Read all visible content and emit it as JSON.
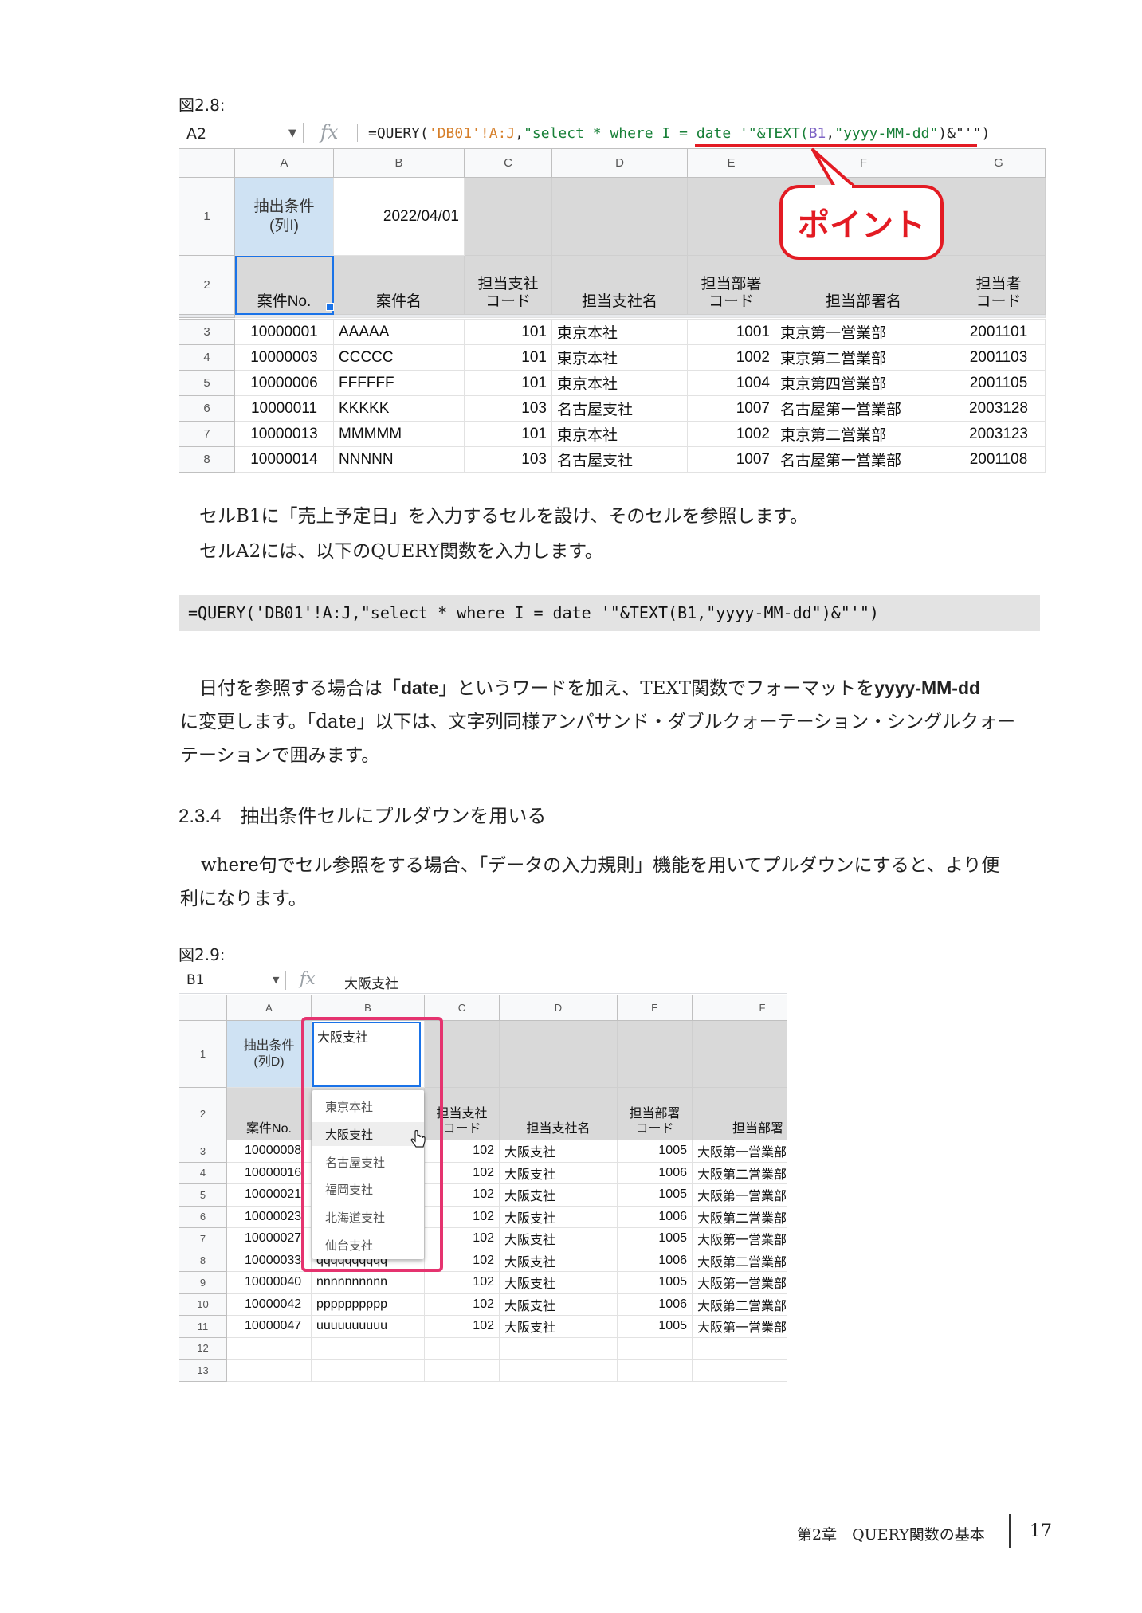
{
  "fig1": {
    "label": "図2.8:",
    "namebox": "A2",
    "fx": "fx",
    "formula": {
      "p1": "=QUERY(",
      "p2": "'DB01'!A:J",
      "p3": ",",
      "p4": "\"select * where I = ",
      "p5": "date '\"&TEXT(",
      "p6": "B1",
      "p7": ",",
      "p8": "\"yyyy-MM-dd\"",
      "p9": ")&\"'\")"
    },
    "callout": "ポイント",
    "col_headers": [
      "A",
      "B",
      "C",
      "D",
      "E",
      "F",
      "G"
    ],
    "row1": {
      "num": "1",
      "a_line1": "抽出条件",
      "a_line2": "(列I)",
      "b": "2022/04/01"
    },
    "row2": {
      "num": "2",
      "a": "案件No.",
      "b": "案件名",
      "c1": "担当支社",
      "c2": "コード",
      "d": "担当支社名",
      "e1": "担当部署",
      "e2": "コード",
      "f": "担当部署名",
      "g1": "担当者",
      "g2": "コード"
    },
    "rows": [
      [
        "3",
        "10000001",
        "AAAAA",
        "101",
        "東京本社",
        "1001",
        "東京第一営業部",
        "2001101"
      ],
      [
        "4",
        "10000003",
        "CCCCC",
        "101",
        "東京本社",
        "1002",
        "東京第二営業部",
        "2001103"
      ],
      [
        "5",
        "10000006",
        "FFFFFF",
        "101",
        "東京本社",
        "1004",
        "東京第四営業部",
        "2001105"
      ],
      [
        "6",
        "10000011",
        "KKKKK",
        "103",
        "名古屋支社",
        "1007",
        "名古屋第一営業部",
        "2003128"
      ],
      [
        "7",
        "10000013",
        "MMMMM",
        "101",
        "東京本社",
        "1002",
        "東京第二営業部",
        "2003123"
      ],
      [
        "8",
        "10000014",
        "NNNNN",
        "103",
        "名古屋支社",
        "1007",
        "名古屋第一営業部",
        "2001108"
      ]
    ]
  },
  "text1": {
    "line1": "セルB1に「売上予定日」を入力するセルを設け、そのセルを参照します。",
    "line2": "セルA2には、以下のQUERY関数を入力します。"
  },
  "code": "=QUERY('DB01'!A:J,\"select * where I = date '\"&TEXT(B1,\"yyyy-MM-dd\")&\"'\")",
  "text2": {
    "l1a": "日付を参照する場合は「",
    "l1b": "date",
    "l1c": "」というワードを加え、TEXT関数でフォーマットを",
    "l1d": "yyyy-MM-dd",
    "line2": "に変更します。「date」以下は、文字列同様アンパサンド・ダブルクォーテーション・シングルクォー",
    "line3": "テーションで囲みます。"
  },
  "heading": "2.3.4　抽出条件セルにプルダウンを用いる",
  "text3": {
    "line1": "where句でセル参照をする場合、「データの入力規則」機能を用いてプルダウンにすると、より便",
    "line2": "利になります。"
  },
  "fig2": {
    "label": "図2.9:",
    "namebox": "B1",
    "fx": "fx",
    "formula": "大阪支社",
    "col_headers": [
      "A",
      "B",
      "C",
      "D",
      "E",
      "F"
    ],
    "row1": {
      "num": "1",
      "a_line1": "抽出条件",
      "a_line2": "(列D)",
      "b": "大阪支社"
    },
    "row2": {
      "num": "2",
      "a": "案件No.",
      "c1": "担当支社",
      "c2": "コード",
      "d": "担当支社名",
      "e1": "担当部署",
      "e2": "コード",
      "f": "担当部署"
    },
    "rows": [
      [
        "3",
        "10000008",
        "",
        "102",
        "大阪支社",
        "1005",
        "大阪第一営業部"
      ],
      [
        "4",
        "10000016",
        "",
        "102",
        "大阪支社",
        "1006",
        "大阪第二営業部"
      ],
      [
        "5",
        "10000021",
        "",
        "102",
        "大阪支社",
        "1005",
        "大阪第一営業部"
      ],
      [
        "6",
        "10000023",
        "",
        "102",
        "大阪支社",
        "1006",
        "大阪第二営業部"
      ],
      [
        "7",
        "10000027",
        "",
        "102",
        "大阪支社",
        "1005",
        "大阪第一営業部"
      ],
      [
        "8",
        "10000033",
        "qqqqqqqqqq",
        "102",
        "大阪支社",
        "1006",
        "大阪第二営業部"
      ],
      [
        "9",
        "10000040",
        "nnnnnnnnnn",
        "102",
        "大阪支社",
        "1005",
        "大阪第一営業部"
      ],
      [
        "10",
        "10000042",
        "pppppppppp",
        "102",
        "大阪支社",
        "1006",
        "大阪第二営業部"
      ],
      [
        "11",
        "10000047",
        "uuuuuuuuuu",
        "102",
        "大阪支社",
        "1005",
        "大阪第一営業部"
      ],
      [
        "12",
        "",
        "",
        "",
        "",
        "",
        ""
      ],
      [
        "13",
        "",
        "",
        "",
        "",
        "",
        ""
      ]
    ],
    "dropdown": [
      "東京本社",
      "大阪支社",
      "名古屋支社",
      "福岡支社",
      "北海道支社",
      "仙台支社"
    ]
  },
  "footer": {
    "chapter": "第2章　QUERY関数の基本",
    "page": "17"
  },
  "colors": {
    "red": "#e31b23",
    "pink": "#e5336f",
    "blue_sel": "#1a73e8",
    "gray_cell": "#d9d9d9",
    "blue_cell": "#cfe2f3"
  }
}
